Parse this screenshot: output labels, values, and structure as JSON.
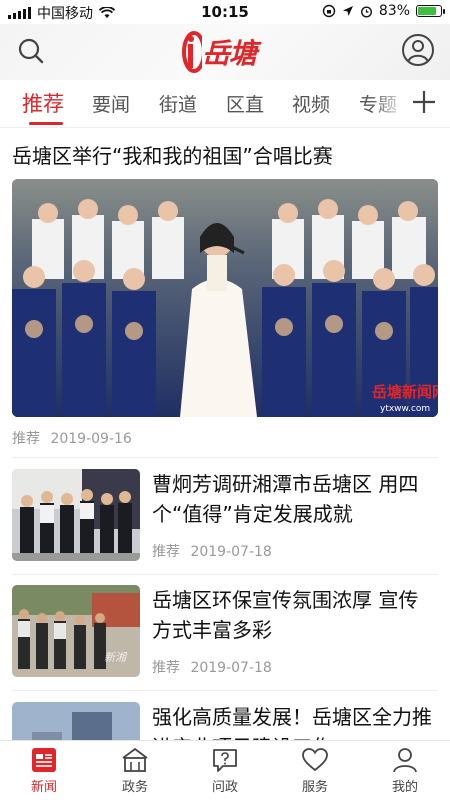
{
  "status_bar": {
    "carrier": "中国移动",
    "time": "10:15",
    "battery": "83%",
    "battery_level": 0.83
  },
  "header": {
    "logo_text": "岳塘",
    "search_icon": "search-icon",
    "user_icon": "user-circle-icon"
  },
  "tabs": [
    {
      "label": "推荐",
      "active": true
    },
    {
      "label": "要闻"
    },
    {
      "label": "街道"
    },
    {
      "label": "区直"
    },
    {
      "label": "视频"
    },
    {
      "label": "专题"
    }
  ],
  "tab_add_icon": "plus-icon",
  "featured": {
    "title": "岳塘区举行“我和我的祖国”合唱比赛",
    "tag": "推荐",
    "date": "2019-09-16",
    "watermark": "岳塘新闻网",
    "watermark_url": "ytxww.com"
  },
  "news": [
    {
      "title": "曹炯芳调研湘潭市岳塘区 用四个“值得”肯定发展成就",
      "tag": "推荐",
      "date": "2019-07-18"
    },
    {
      "title": "岳塘区环保宣传氛围浓厚 宣传方式丰富多彩",
      "tag": "推荐",
      "date": "2019-07-18"
    },
    {
      "title": "强化高质量发展！岳塘区全力推进产业项目建设工作"
    }
  ],
  "bottom_nav": [
    {
      "label": "新闻",
      "icon": "news-icon",
      "active": true
    },
    {
      "label": "政务",
      "icon": "government-icon"
    },
    {
      "label": "问政",
      "icon": "question-chat-icon"
    },
    {
      "label": "服务",
      "icon": "heart-icon"
    },
    {
      "label": "我的",
      "icon": "person-icon"
    }
  ],
  "colors": {
    "accent": "#e0262a",
    "meta_text": "#999999"
  }
}
